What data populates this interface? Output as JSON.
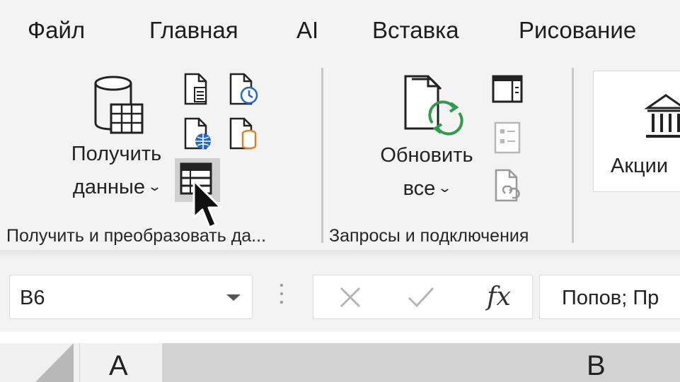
{
  "menu": {
    "tabs": [
      {
        "label": "Файл"
      },
      {
        "label": "Главная"
      },
      {
        "label": "AI"
      },
      {
        "label": "Вставка"
      },
      {
        "label": "Рисование"
      }
    ]
  },
  "ribbon": {
    "get_data": {
      "line1": "Получить",
      "line2": "данные",
      "chevron": "⌄",
      "icon": "database-table-icon"
    },
    "small_icons": [
      {
        "name": "from-text-csv-icon"
      },
      {
        "name": "recent-sources-icon"
      },
      {
        "name": "from-web-icon"
      },
      {
        "name": "existing-connections-icon"
      },
      {
        "name": "from-table-range-icon"
      }
    ],
    "group1_label": "Получить и преобразовать да...",
    "refresh": {
      "line1": "Обновить",
      "line2": "все",
      "chevron": "⌄",
      "icon": "refresh-all-icon"
    },
    "queries_icons": [
      {
        "name": "queries-connections-icon"
      },
      {
        "name": "properties-icon"
      },
      {
        "name": "edit-links-icon"
      }
    ],
    "group2_label": "Запросы и подключения",
    "stocks": {
      "label": "Акции",
      "icon": "bank-icon"
    }
  },
  "formula_bar": {
    "name_box": "B6",
    "cancel_icon": "close-icon",
    "enter_icon": "checkmark-icon",
    "fx_label": "fx",
    "formula_value": "Попов; Пр"
  },
  "sheet": {
    "columns": [
      "A",
      "B"
    ]
  },
  "colors": {
    "accent_green": "#2e9c4a",
    "accent_blue": "#2468c5",
    "accent_orange": "#d9822b"
  }
}
